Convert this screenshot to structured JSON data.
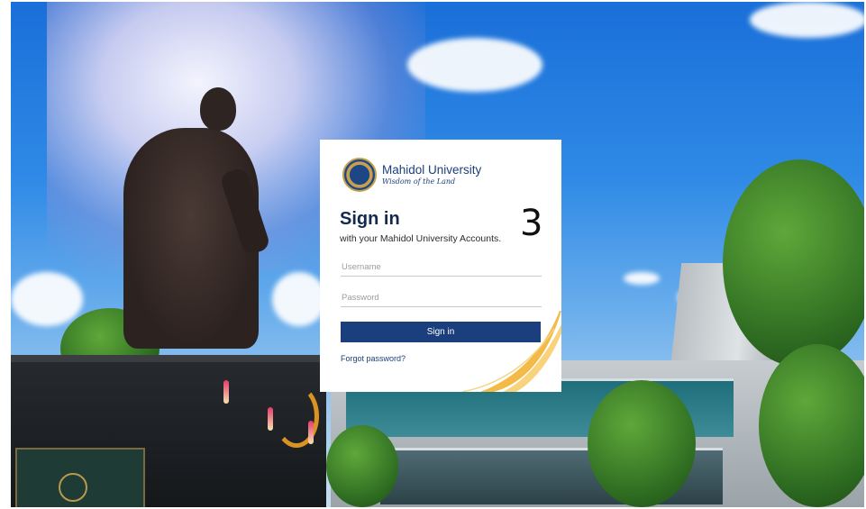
{
  "brand": {
    "name": "Mahidol University",
    "tagline": "Wisdom of the Land"
  },
  "login": {
    "title": "Sign in",
    "subtitle": "with your Mahidol University Accounts.",
    "username_placeholder": "Username",
    "password_placeholder": "Password",
    "signin_label": "Sign in",
    "forgot_label": "Forgot password?"
  },
  "annotation": {
    "step_number": "3"
  },
  "colors": {
    "primary_navy": "#1b3f7c",
    "seal_gold": "#c6a04c",
    "swoosh_gold": "#f2b233"
  },
  "icons": {
    "seal": "mahidol-seal-icon"
  }
}
